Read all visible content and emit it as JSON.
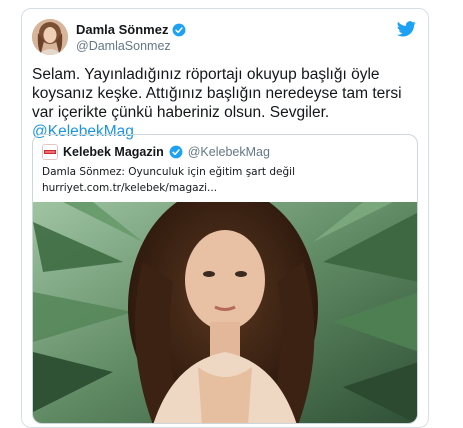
{
  "tweet": {
    "author": {
      "display_name": "Damla Sönmez",
      "handle": "@DamlaSonmez",
      "verified": true,
      "avatar_icon": "profile-photo"
    },
    "text_main": "Selam. Yayınladığınız röportajı okuyup başlığı öyle koysanız keşke. Attığınız başlığın neredeyse tam tersi var içerikte çünkü haberiniz olsun. Sevgiler. ",
    "mention": "@KelebekMag",
    "platform_icon": "twitter-bird-icon",
    "colors": {
      "mention": "#1b95e0",
      "verified": "#1da1f2",
      "secondary_text": "#657786"
    }
  },
  "quoted": {
    "author": {
      "display_name": "Kelebek Magazin",
      "handle": "@KelebekMag",
      "verified": true,
      "logo_icon": "kelebek-logo"
    },
    "headline": "Damla Sönmez: Oyunculuk için eğitim şart değil",
    "link": "hurriyet.com.tr/kelebek/magazi...",
    "image_icon": "article-photo"
  }
}
